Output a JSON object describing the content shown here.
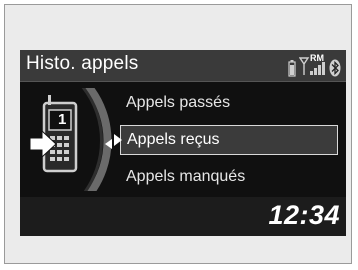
{
  "header": {
    "title": "Histo. appels",
    "roaming": "RM"
  },
  "menu": {
    "items": [
      {
        "label": "Appels passés",
        "selected": false
      },
      {
        "label": "Appels reçus",
        "selected": true
      },
      {
        "label": "Appels manqués",
        "selected": false
      }
    ],
    "phone_digit": "1"
  },
  "footer": {
    "clock": "12:34"
  },
  "colors": {
    "screen_bg": "#232323",
    "header_bg": "#3a3a3a",
    "selection_border": "#d9d9d9"
  }
}
